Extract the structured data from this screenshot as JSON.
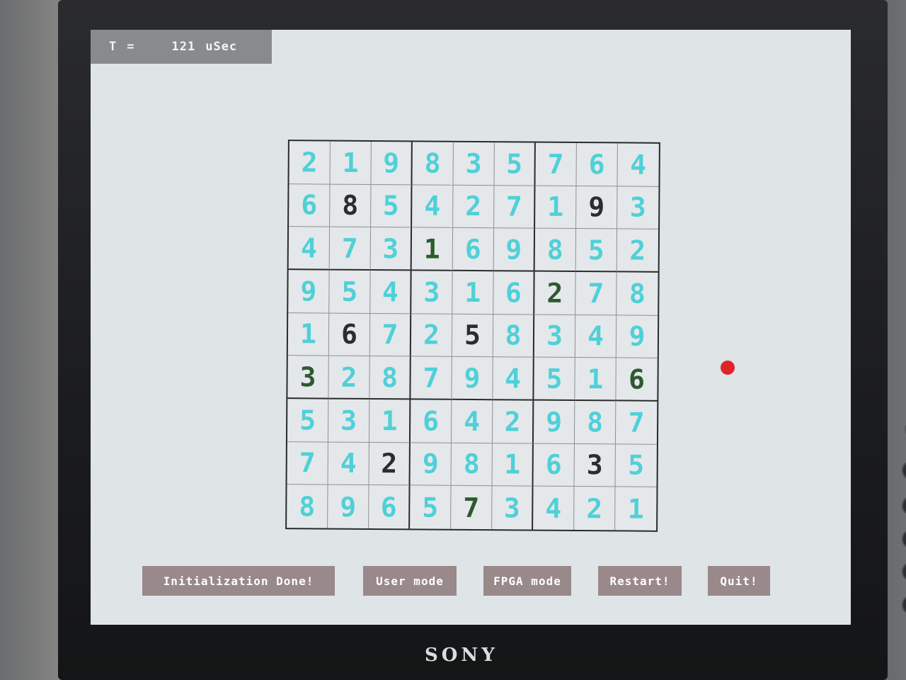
{
  "timer": {
    "label": "T",
    "equals": "=",
    "value": "121",
    "unit": "uSec"
  },
  "sudoku": {
    "rows": [
      [
        {
          "v": "2",
          "t": "solved"
        },
        {
          "v": "1",
          "t": "solved"
        },
        {
          "v": "9",
          "t": "solved"
        },
        {
          "v": "8",
          "t": "solved"
        },
        {
          "v": "3",
          "t": "solved"
        },
        {
          "v": "5",
          "t": "solved"
        },
        {
          "v": "7",
          "t": "solved"
        },
        {
          "v": "6",
          "t": "solved"
        },
        {
          "v": "4",
          "t": "solved"
        }
      ],
      [
        {
          "v": "6",
          "t": "solved"
        },
        {
          "v": "8",
          "t": "given"
        },
        {
          "v": "5",
          "t": "solved"
        },
        {
          "v": "4",
          "t": "solved"
        },
        {
          "v": "2",
          "t": "solved"
        },
        {
          "v": "7",
          "t": "solved"
        },
        {
          "v": "1",
          "t": "solved"
        },
        {
          "v": "9",
          "t": "given"
        },
        {
          "v": "3",
          "t": "solved"
        }
      ],
      [
        {
          "v": "4",
          "t": "solved"
        },
        {
          "v": "7",
          "t": "solved"
        },
        {
          "v": "3",
          "t": "solved"
        },
        {
          "v": "1",
          "t": "user"
        },
        {
          "v": "6",
          "t": "solved"
        },
        {
          "v": "9",
          "t": "solved"
        },
        {
          "v": "8",
          "t": "solved"
        },
        {
          "v": "5",
          "t": "solved"
        },
        {
          "v": "2",
          "t": "solved"
        }
      ],
      [
        {
          "v": "9",
          "t": "solved"
        },
        {
          "v": "5",
          "t": "solved"
        },
        {
          "v": "4",
          "t": "solved"
        },
        {
          "v": "3",
          "t": "solved"
        },
        {
          "v": "1",
          "t": "solved"
        },
        {
          "v": "6",
          "t": "solved"
        },
        {
          "v": "2",
          "t": "user"
        },
        {
          "v": "7",
          "t": "solved"
        },
        {
          "v": "8",
          "t": "solved"
        }
      ],
      [
        {
          "v": "1",
          "t": "solved"
        },
        {
          "v": "6",
          "t": "given"
        },
        {
          "v": "7",
          "t": "solved"
        },
        {
          "v": "2",
          "t": "solved"
        },
        {
          "v": "5",
          "t": "given"
        },
        {
          "v": "8",
          "t": "solved"
        },
        {
          "v": "3",
          "t": "solved"
        },
        {
          "v": "4",
          "t": "solved"
        },
        {
          "v": "9",
          "t": "solved"
        }
      ],
      [
        {
          "v": "3",
          "t": "user"
        },
        {
          "v": "2",
          "t": "solved"
        },
        {
          "v": "8",
          "t": "solved"
        },
        {
          "v": "7",
          "t": "solved"
        },
        {
          "v": "9",
          "t": "solved"
        },
        {
          "v": "4",
          "t": "solved"
        },
        {
          "v": "5",
          "t": "solved"
        },
        {
          "v": "1",
          "t": "solved"
        },
        {
          "v": "6",
          "t": "user"
        }
      ],
      [
        {
          "v": "5",
          "t": "solved"
        },
        {
          "v": "3",
          "t": "solved"
        },
        {
          "v": "1",
          "t": "solved"
        },
        {
          "v": "6",
          "t": "solved"
        },
        {
          "v": "4",
          "t": "solved"
        },
        {
          "v": "2",
          "t": "solved"
        },
        {
          "v": "9",
          "t": "solved"
        },
        {
          "v": "8",
          "t": "solved"
        },
        {
          "v": "7",
          "t": "solved"
        }
      ],
      [
        {
          "v": "7",
          "t": "solved"
        },
        {
          "v": "4",
          "t": "solved"
        },
        {
          "v": "2",
          "t": "given"
        },
        {
          "v": "9",
          "t": "solved"
        },
        {
          "v": "8",
          "t": "solved"
        },
        {
          "v": "1",
          "t": "solved"
        },
        {
          "v": "6",
          "t": "solved"
        },
        {
          "v": "3",
          "t": "given"
        },
        {
          "v": "5",
          "t": "solved"
        }
      ],
      [
        {
          "v": "8",
          "t": "solved"
        },
        {
          "v": "9",
          "t": "solved"
        },
        {
          "v": "6",
          "t": "solved"
        },
        {
          "v": "5",
          "t": "solved"
        },
        {
          "v": "7",
          "t": "user"
        },
        {
          "v": "3",
          "t": "solved"
        },
        {
          "v": "4",
          "t": "solved"
        },
        {
          "v": "2",
          "t": "solved"
        },
        {
          "v": "1",
          "t": "solved"
        }
      ]
    ]
  },
  "buttons": {
    "init_done": "Initialization Done!",
    "user_mode": "User mode",
    "fpga_mode": "FPGA mode",
    "restart": "Restart!",
    "quit": "Quit!"
  },
  "monitor": {
    "brand": "SONY"
  },
  "colors": {
    "solved_digit": "#4fd0d8",
    "given_digit": "#2e2c2a",
    "user_digit": "#2d5a2e",
    "cursor": "#e0252a",
    "button_bg": "#99898a",
    "screen_bg": "#dfe4e7"
  }
}
